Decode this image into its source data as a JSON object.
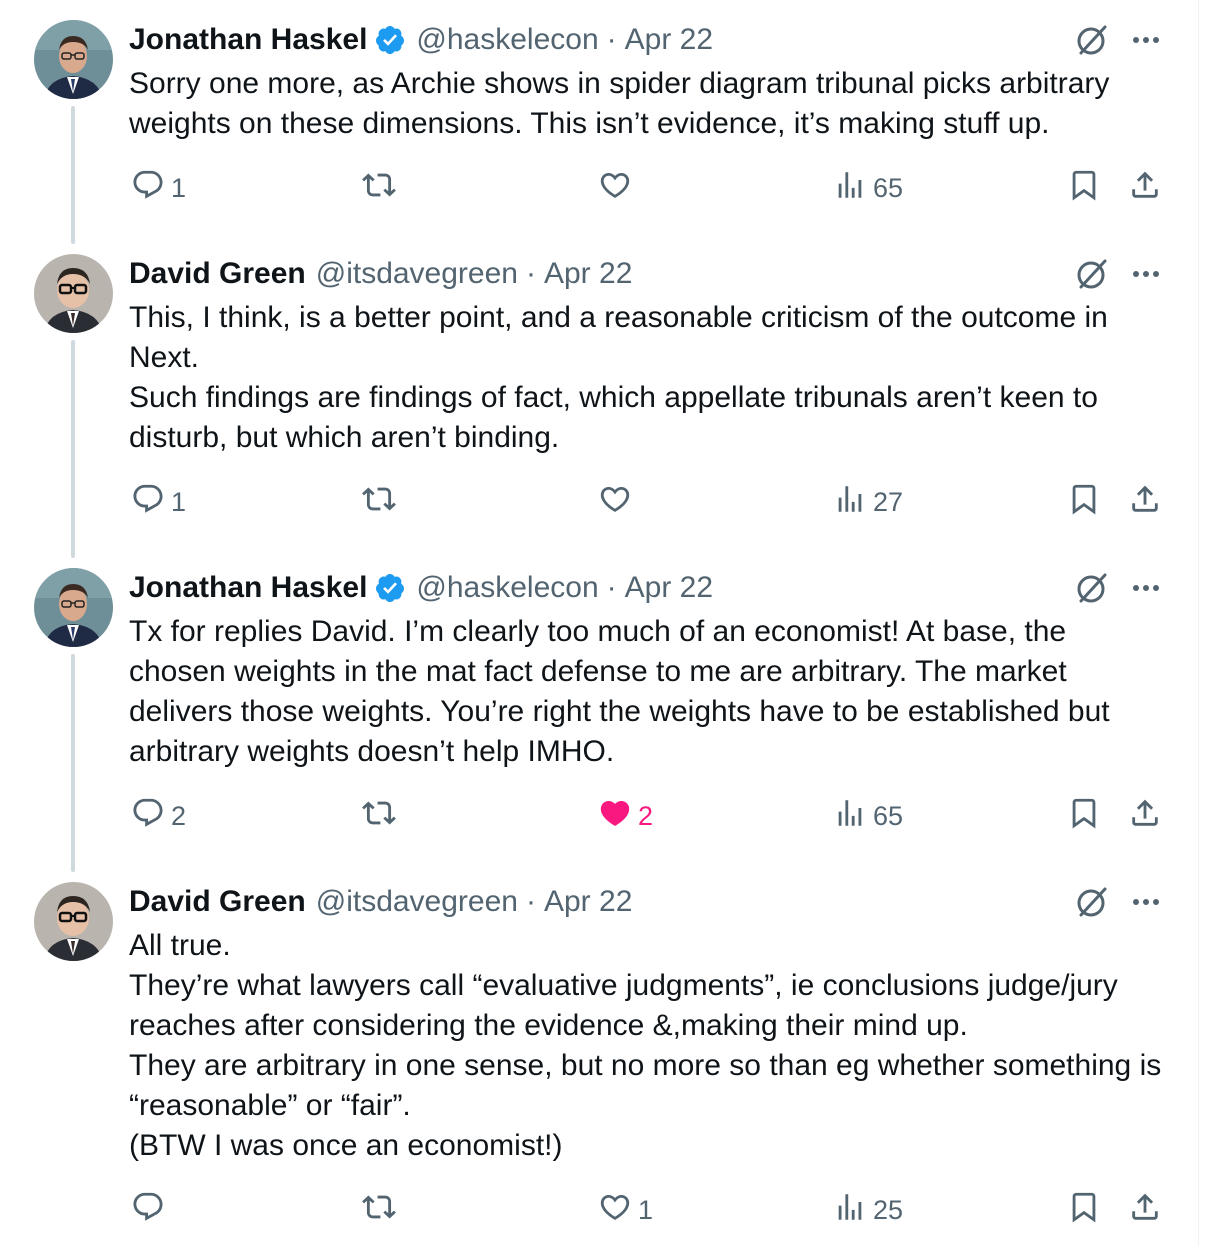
{
  "tweets": [
    {
      "author": "Jonathan Haskel",
      "verified": true,
      "handle": "@haskelecon",
      "date": "Apr 22",
      "lines": [
        "Sorry one more, as Archie shows in spider diagram tribunal picks arbitrary weights on these dimensions. This isn’t evidence, it’s making stuff up."
      ],
      "replies": "1",
      "reposts": "",
      "likes": "",
      "views": "65",
      "liked": false
    },
    {
      "author": "David Green",
      "verified": false,
      "handle": "@itsdavegreen",
      "date": "Apr 22",
      "lines": [
        "This, I think, is a better point, and a reasonable criticism of the outcome in Next.",
        "Such findings are findings of fact, which appellate tribunals aren’t keen to disturb, but which aren’t binding."
      ],
      "replies": "1",
      "reposts": "",
      "likes": "",
      "views": "27",
      "liked": false
    },
    {
      "author": "Jonathan Haskel",
      "verified": true,
      "handle": "@haskelecon",
      "date": "Apr 22",
      "lines": [
        "Tx for replies David. I’m clearly too much of an economist! At base, the chosen weights in the mat fact defense to me are arbitrary. The market delivers those weights. You’re right the weights have to be established but arbitrary weights doesn’t help IMHO."
      ],
      "replies": "2",
      "reposts": "",
      "likes": "2",
      "views": "65",
      "liked": true
    },
    {
      "author": "David Green",
      "verified": false,
      "handle": "@itsdavegreen",
      "date": "Apr 22",
      "lines": [
        "All true.",
        "They’re what lawyers call “evaluative judgments”, ie conclusions judge/jury reaches after considering the evidence &,making their mind up.",
        "They are arbitrary in one sense, but no more so than eg whether something is “reasonable” or “fair”.",
        "(BTW I was once an economist!)"
      ],
      "replies": "",
      "reposts": "",
      "likes": "1",
      "views": "25",
      "liked": false
    }
  ],
  "colors": {
    "text": "#0f1419",
    "muted": "#536471",
    "verified": "#1d9bf0",
    "like": "#f91880",
    "thread_line": "#cfd9de"
  },
  "icons": [
    "verified-badge-icon",
    "grok-icon",
    "more-icon",
    "reply-icon",
    "repost-icon",
    "like-icon",
    "views-icon",
    "bookmark-icon",
    "share-icon"
  ]
}
